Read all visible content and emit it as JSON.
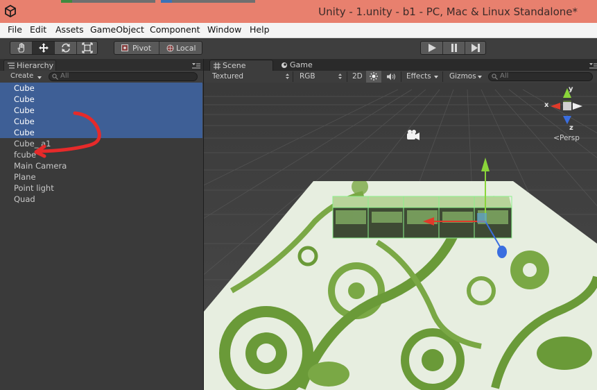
{
  "window": {
    "title": "Unity - 1.unity - b1 - PC, Mac & Linux Standalone*",
    "title_bar_color": "#e8806e"
  },
  "menu": {
    "items": [
      "File",
      "Edit",
      "Assets",
      "GameObject",
      "Component",
      "Window",
      "Help"
    ]
  },
  "toolbar": {
    "tools": [
      "hand-icon",
      "move-icon",
      "rotate-icon",
      "scale-icon"
    ],
    "active_tool": "move-icon",
    "pivot_label": "Pivot",
    "local_label": "Local",
    "play_controls": [
      "play-icon",
      "pause-icon",
      "step-icon"
    ]
  },
  "hierarchy": {
    "tab_label": "Hierarchy",
    "create_label": "Create",
    "search_placeholder": "All",
    "items": [
      {
        "label": "Cube",
        "selected": true
      },
      {
        "label": "Cube",
        "selected": true
      },
      {
        "label": "Cube",
        "selected": true
      },
      {
        "label": "Cube",
        "selected": true
      },
      {
        "label": "Cube",
        "selected": true
      },
      {
        "label": "Cube_ a1",
        "selected": false
      },
      {
        "label": "fcube",
        "selected": false
      },
      {
        "label": "Main Camera",
        "selected": false
      },
      {
        "label": "Plane",
        "selected": false
      },
      {
        "label": "Point light",
        "selected": false
      },
      {
        "label": "Quad",
        "selected": false
      }
    ],
    "selection_color": "#3e5f96"
  },
  "scene": {
    "tabs": [
      {
        "label": "Scene",
        "active": true
      },
      {
        "label": "Game",
        "active": false
      }
    ],
    "shading_mode": "Textured",
    "render_mode": "RGB",
    "mode_2d_label": "2D",
    "effects_label": "Effects",
    "gizmos_label": "Gizmos",
    "search_placeholder": "All",
    "gizmo": {
      "axis_y": "y",
      "axis_x": "x",
      "axis_z": "z",
      "projection_label": "Persp"
    }
  }
}
